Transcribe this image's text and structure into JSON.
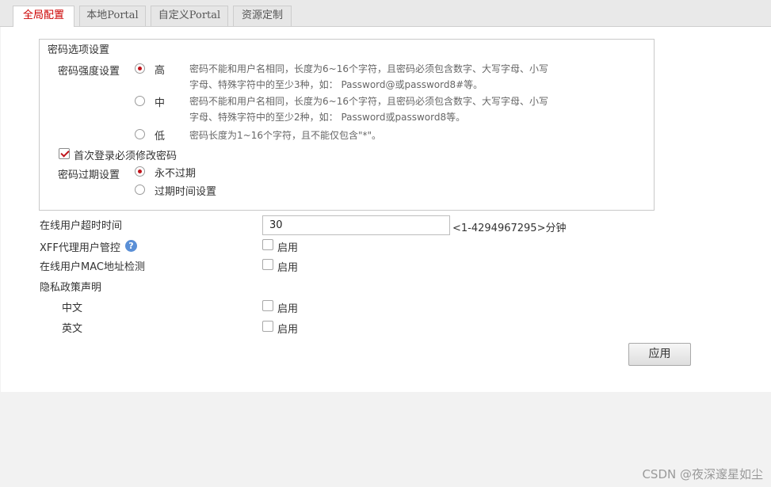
{
  "tabs": [
    {
      "label": "全局配置"
    },
    {
      "label": "本地Portal"
    },
    {
      "label": "自定义Portal"
    },
    {
      "label": "资源定制"
    }
  ],
  "password_options": {
    "legend": "密码选项设置",
    "strength_label": "密码强度设置",
    "strength_levels": [
      {
        "label": "高",
        "selected": true,
        "desc_line1": "密码不能和用户名相同，长度为6~16个字符，且密码必须包含数字、大写字母、小写",
        "desc_line2": "字母、特殊字符中的至少3种，如： Password@或password8#等。"
      },
      {
        "label": "中",
        "selected": false,
        "desc_line1": "密码不能和用户名相同，长度为6~16个字符，且密码必须包含数字、大写字母、小写",
        "desc_line2": "字母、特殊字符中的至少2种，如： Password或password8等。"
      },
      {
        "label": "低",
        "selected": false,
        "desc_line1": "密码长度为1~16个字符，且不能仅包含\"*\"。"
      }
    ],
    "first_login_change": {
      "label": "首次登录必须修改密码",
      "checked": true
    },
    "expiry_label": "密码过期设置",
    "expiry_options": [
      {
        "label": "永不过期",
        "selected": true
      },
      {
        "label": "过期时间设置",
        "selected": false
      }
    ]
  },
  "settings": {
    "timeout_label": "在线用户超时时间",
    "timeout_value": "30",
    "timeout_range": "<1-4294967295>分钟",
    "xff_label": "XFF代理用户管控",
    "help_glyph": "?",
    "mac_label": "在线用户MAC地址检测",
    "privacy_label": "隐私政策声明",
    "privacy_cn_label": "中文",
    "privacy_en_label": "英文",
    "enable_label": "启用"
  },
  "apply_label": "应用",
  "watermark": "CSDN @夜深邃星如尘",
  "colors": {
    "accent": "#c0141b",
    "help": "#5a8fd6"
  }
}
